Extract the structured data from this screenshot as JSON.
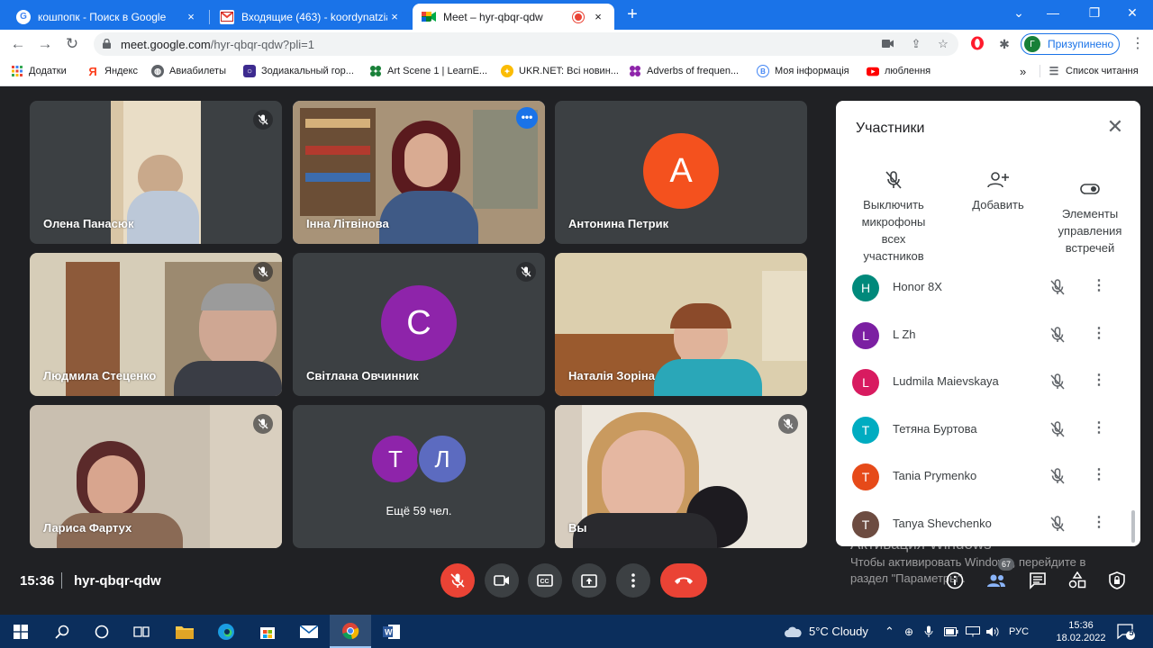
{
  "browser": {
    "tabs": [
      {
        "title": "кошпопк - Поиск в Google",
        "favicon": "google-icon",
        "close": "×"
      },
      {
        "title": "Входящие (463) - koordynatzia@",
        "favicon": "gmail-icon",
        "close": "×"
      },
      {
        "title": "Meet – hyr-qbqr-qdw",
        "favicon": "meet-icon",
        "close": "×"
      }
    ],
    "new_tab": "+",
    "url": "meet.google.com",
    "url_path": "/hyr-qbqr-qdw?pli=1",
    "profile_initial": "Г",
    "profile_label": "Призупинено",
    "bookmarks": [
      {
        "label": "Додатки",
        "icon": "apps-grid-icon"
      },
      {
        "label": "Яндекс",
        "icon": "yandex-icon"
      },
      {
        "label": "Авиабилеты",
        "icon": "globe-icon"
      },
      {
        "label": "Зодиакальный гор...",
        "icon": "zodiac-icon"
      },
      {
        "label": "Art Scene 1 | LearnE...",
        "icon": "learnenglish-icon"
      },
      {
        "label": "UKR.NET: Всі новин...",
        "icon": "ukrnet-icon"
      },
      {
        "label": "Adverbs of frequen...",
        "icon": "learnenglish-icon"
      },
      {
        "label": "Моя інформація",
        "icon": "info-icon"
      },
      {
        "label": "люблення",
        "icon": "youtube-icon"
      }
    ],
    "bookmarks_overflow": "»",
    "reading_list": "Список читання"
  },
  "meet": {
    "tiles": [
      {
        "name": "Олена Панасюк",
        "muted": true
      },
      {
        "name": "Інна Літвінова",
        "muted": false,
        "more": "•••"
      },
      {
        "name": "Антонина Петрик",
        "avatar": "А",
        "avatar_color": "#f4511e",
        "muted": false
      },
      {
        "name": "Людмила Стеценко",
        "muted": true
      },
      {
        "name": "Світлана Овчинник",
        "avatar": "С",
        "avatar_color": "#8e24aa",
        "muted": true
      },
      {
        "name": "Наталія Зоріна",
        "muted": false
      },
      {
        "name": "Лариса Фартух",
        "muted": true
      },
      {
        "more_count": "Ещё 59 чел.",
        "avatars": [
          "Т",
          "Л"
        ],
        "avatar_colors": [
          "#8e24aa",
          "#5c6bc0"
        ]
      },
      {
        "name": "Вы",
        "muted": true
      }
    ],
    "time": "15:36",
    "meeting_code": "hyr-qbqr-qdw",
    "people_count": "67"
  },
  "participants_panel": {
    "title": "Участники",
    "actions": [
      {
        "label": "Выключить микрофоны всех участников",
        "icon": "mic-off-icon"
      },
      {
        "label": "Добавить",
        "icon": "person-add-icon"
      },
      {
        "label": "Элементы управления встречей",
        "icon": "toggle-icon"
      }
    ],
    "people": [
      {
        "initial": "H",
        "name": "Honor 8X",
        "color": "#00897b"
      },
      {
        "initial": "L",
        "name": "L Zh",
        "color": "#7b1fa2"
      },
      {
        "initial": "L",
        "name": "Ludmila Maievskaya",
        "color": "#d81b60"
      },
      {
        "initial": "T",
        "name": "Тетяна Буртова",
        "color": "#00acc1"
      },
      {
        "initial": "T",
        "name": "Tania Prymenko",
        "color": "#e64a19"
      },
      {
        "initial": "T",
        "name": "Tanya Shevchenko",
        "color": "#6d4c41"
      }
    ]
  },
  "watermark": {
    "title": "Активация Windows",
    "line1": "Чтобы активировать Windows, перейдите в",
    "line2": "раздел \"Параметры\"."
  },
  "taskbar": {
    "weather": "5°C  Cloudy",
    "language": "РУС",
    "time": "15:36",
    "date": "18.02.2022",
    "notifications": "5"
  }
}
